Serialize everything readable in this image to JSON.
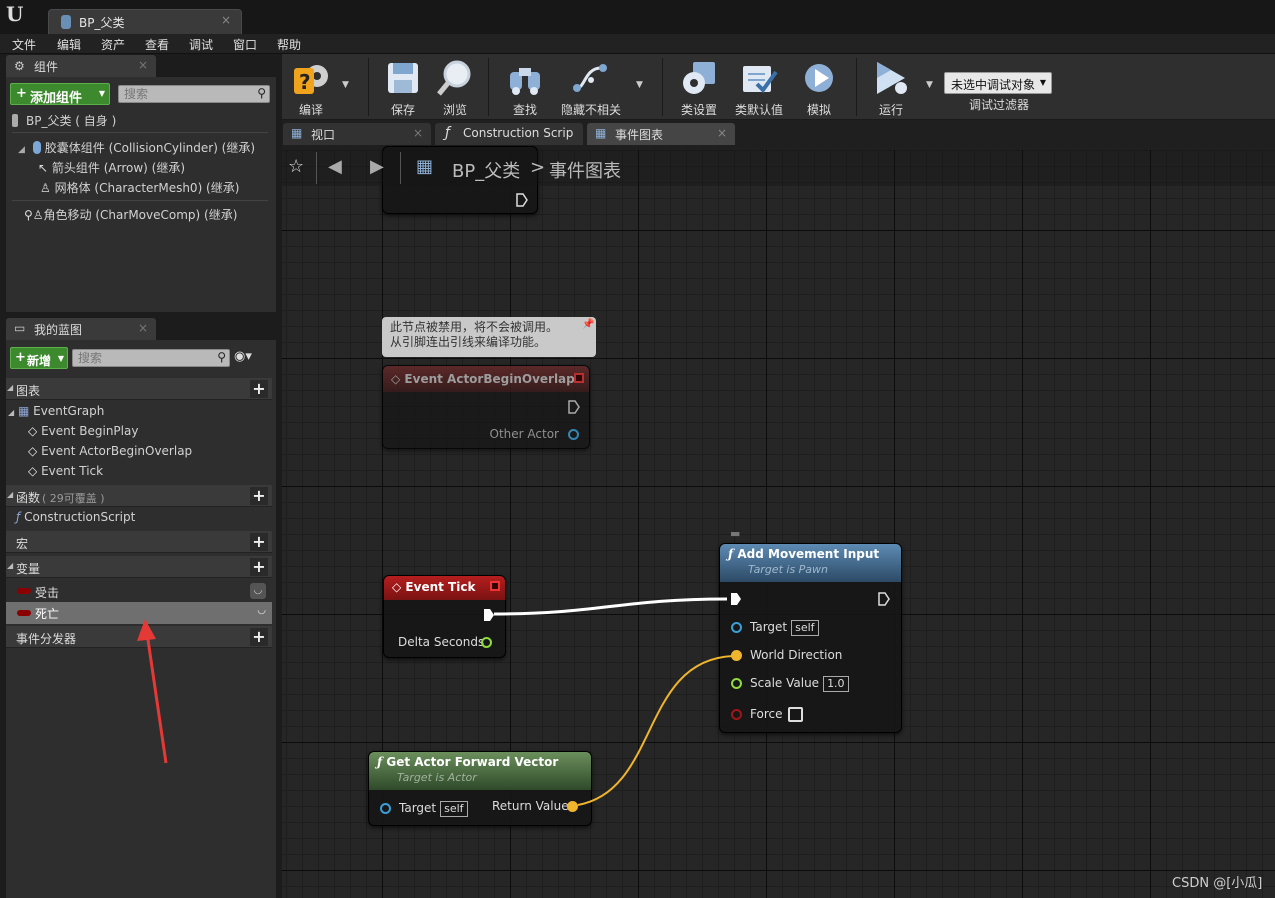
{
  "window": {
    "tab_title": "BP_父类",
    "tab_close": "×"
  },
  "menu": [
    "文件",
    "编辑",
    "资产",
    "查看",
    "调试",
    "窗口",
    "帮助"
  ],
  "components_panel": {
    "tab": "组件",
    "add_button": "添加组件",
    "search_placeholder": "搜索",
    "root": "BP_父类 ( 自身 )",
    "items": [
      "胶囊体组件 (CollisionCylinder) (继承)",
      "箭头组件 (Arrow) (继承)",
      "网格体 (CharacterMesh0) (继承)",
      "角色移动 (CharMoveComp) (继承)"
    ]
  },
  "my_blueprint": {
    "tab": "我的蓝图",
    "new_button": "新增",
    "search_placeholder": "搜索",
    "graphs_section": "图表",
    "event_graph": "EventGraph",
    "events": [
      "Event BeginPlay",
      "Event ActorBeginOverlap",
      "Event Tick"
    ],
    "functions_section": "函数",
    "functions_note": "( 29可覆盖 )",
    "construction_script": "ConstructionScript",
    "macros_section": "宏",
    "variables_section": "变量",
    "variables": [
      "受击",
      "死亡"
    ],
    "dispatchers_section": "事件分发器"
  },
  "toolbar": {
    "compile": "编译",
    "save": "保存",
    "browse": "浏览",
    "find": "查找",
    "hide_unrelated": "隐藏不相关",
    "class_settings": "类设置",
    "class_defaults": "类默认值",
    "simulate": "模拟",
    "play": "运行",
    "debug_object": "未选中调试对象",
    "debug_filter": "调试过滤器"
  },
  "editor_tabs": [
    "视口",
    "Construction Scrip",
    "事件图表"
  ],
  "breadcrumb": {
    "blueprint": "BP_父类",
    "separator": ">",
    "graph": "事件图表"
  },
  "graph": {
    "disabled_comment": "此节点被禁用，将不会被调用。\n从引脚连出引线来编译功能。",
    "node_overlap": {
      "title": "Event ActorBeginOverlap",
      "pin": "Other Actor"
    },
    "node_tick": {
      "title": "Event Tick",
      "pin": "Delta Seconds"
    },
    "node_add_movement": {
      "title": "Add Movement Input",
      "subtitle": "Target is Pawn",
      "pins": {
        "target": "Target",
        "target_val": "self",
        "direction": "World Direction",
        "scale": "Scale Value",
        "scale_val": "1.0",
        "force": "Force"
      }
    },
    "node_forward": {
      "title": "Get Actor Forward Vector",
      "subtitle": "Target is Actor",
      "target": "Target",
      "target_val": "self",
      "return": "Return Value"
    }
  },
  "watermark": "CSDN @[小瓜]",
  "colors": {
    "exec_wire": "#ffffff",
    "vector_wire": "#f0b52c",
    "annotation_arrow": "#e53935"
  }
}
